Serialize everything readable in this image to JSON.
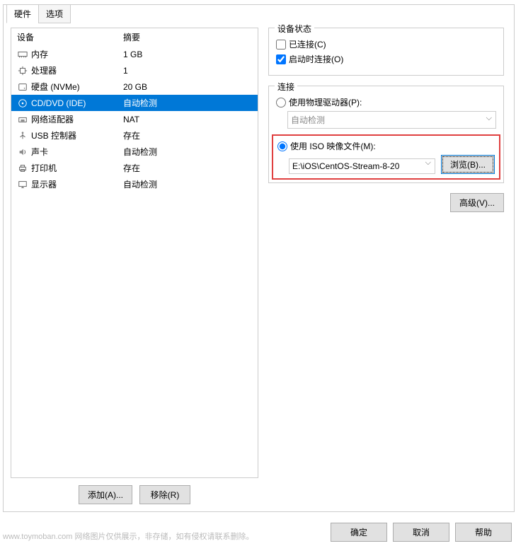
{
  "tabs": {
    "hardware": "硬件",
    "options": "选项"
  },
  "headers": {
    "device": "设备",
    "summary": "摘要"
  },
  "devices": [
    {
      "name": "内存",
      "summary": "1 GB",
      "icon": "memory"
    },
    {
      "name": "处理器",
      "summary": "1",
      "icon": "cpu"
    },
    {
      "name": "硬盘 (NVMe)",
      "summary": "20 GB",
      "icon": "disk"
    },
    {
      "name": "CD/DVD (IDE)",
      "summary": "自动检测",
      "icon": "cd",
      "selected": true
    },
    {
      "name": "网络适配器",
      "summary": "NAT",
      "icon": "network"
    },
    {
      "name": "USB 控制器",
      "summary": "存在",
      "icon": "usb"
    },
    {
      "name": "声卡",
      "summary": "自动检测",
      "icon": "sound"
    },
    {
      "name": "打印机",
      "summary": "存在",
      "icon": "printer"
    },
    {
      "name": "显示器",
      "summary": "自动检测",
      "icon": "display"
    }
  ],
  "buttons": {
    "add": "添加(A)...",
    "remove": "移除(R)",
    "browse": "浏览(B)...",
    "advanced": "高级(V)...",
    "ok": "确定",
    "cancel": "取消",
    "help": "帮助"
  },
  "status_group": {
    "title": "设备状态",
    "connected": "已连接(C)",
    "connect_at_power": "启动时连接(O)"
  },
  "connection_group": {
    "title": "连接",
    "physical": "使用物理驱动器(P):",
    "physical_value": "自动检测",
    "iso": "使用 ISO 映像文件(M):",
    "iso_value": "E:\\iOS\\CentOS-Stream-8-20"
  },
  "watermark": "www.toymoban.com 网络图片仅供展示，非存储，如有侵权请联系删除。"
}
